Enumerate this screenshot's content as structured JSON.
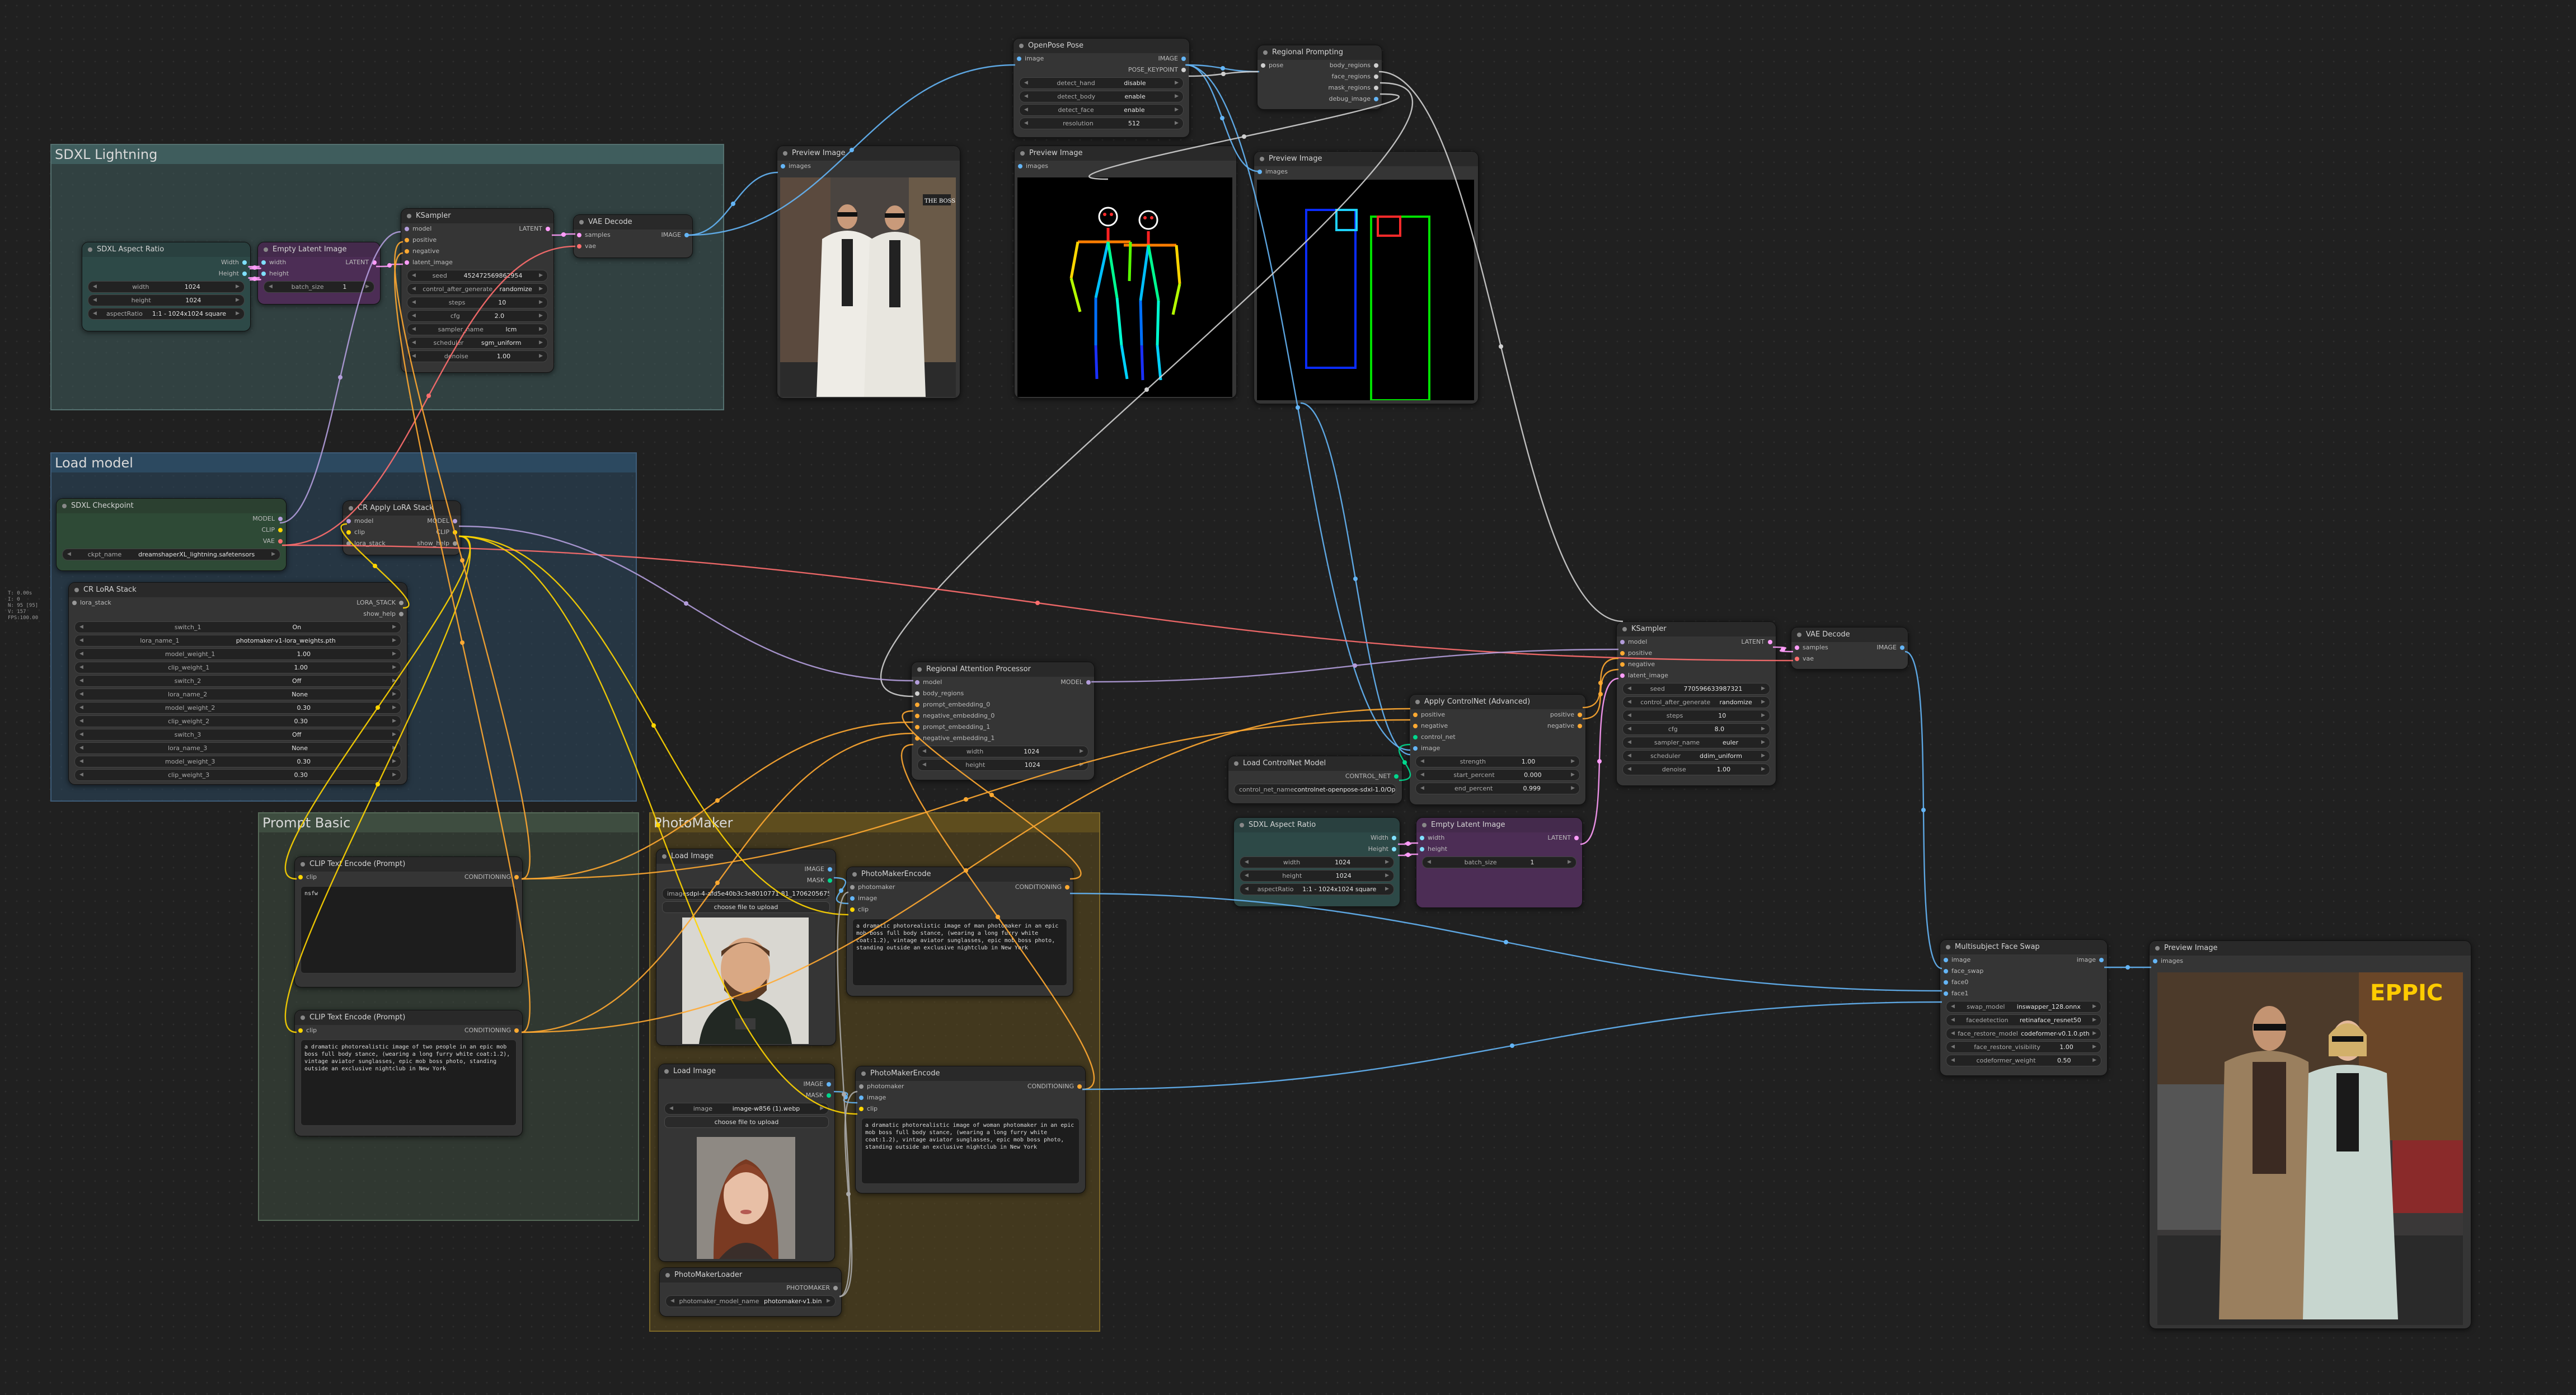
{
  "stats": [
    "T: 0.00s",
    "I: 0",
    "N: 95 [95]",
    "V: 157",
    "FPS:100.00"
  ],
  "groups": {
    "sdxl": "SDXL Lightning",
    "load": "Load model",
    "prompt": "Prompt Basic",
    "photomaker": "PhotoMaker"
  },
  "nodes": {
    "aspect1": {
      "title": "SDXL Aspect Ratio",
      "out": [
        "Width",
        "Height"
      ],
      "w": [
        [
          "width",
          "1024"
        ],
        [
          "height",
          "1024"
        ],
        [
          "aspectRatio",
          "1:1 - 1024x1024 square"
        ]
      ]
    },
    "latent1": {
      "title": "Empty Latent Image",
      "in": [
        "width",
        "height"
      ],
      "out": [
        "LATENT"
      ],
      "w": [
        [
          "batch_size",
          "1"
        ]
      ]
    },
    "ksampler1": {
      "title": "KSampler",
      "in": [
        "model",
        "positive",
        "negative",
        "latent_image"
      ],
      "out": [
        "LATENT"
      ],
      "w": [
        [
          "seed",
          "452472569862954"
        ],
        [
          "control_after_generate",
          "randomize"
        ],
        [
          "steps",
          "10"
        ],
        [
          "cfg",
          "2.0"
        ],
        [
          "sampler_name",
          "lcm"
        ],
        [
          "scheduler",
          "sgm_uniform"
        ],
        [
          "denoise",
          "1.00"
        ]
      ]
    },
    "vae1": {
      "title": "VAE Decode",
      "in": [
        "samples",
        "vae"
      ],
      "out": [
        "IMAGE"
      ]
    },
    "prev1": {
      "title": "Preview Image",
      "in": [
        "images"
      ]
    },
    "openpose": {
      "title": "OpenPose Pose",
      "in": [
        "image"
      ],
      "out": [
        "IMAGE",
        "POSE_KEYPOINT"
      ],
      "w": [
        [
          "detect_hand",
          "disable"
        ],
        [
          "detect_body",
          "enable"
        ],
        [
          "detect_face",
          "enable"
        ],
        [
          "resolution",
          "512"
        ]
      ]
    },
    "prev2": {
      "title": "Preview Image",
      "in": [
        "images"
      ]
    },
    "regional": {
      "title": "Regional Prompting",
      "in": [
        "pose"
      ],
      "out": [
        "body_regions",
        "face_regions",
        "mask_regions",
        "debug_image"
      ]
    },
    "prev3": {
      "title": "Preview Image",
      "in": [
        "images"
      ]
    },
    "checkpoint": {
      "title": "SDXL Checkpoint",
      "out": [
        "MODEL",
        "CLIP",
        "VAE"
      ],
      "w": [
        [
          "ckpt_name",
          "dreamshaperXL_lightning.safetensors"
        ]
      ]
    },
    "applylora": {
      "title": "CR Apply LoRA Stack",
      "in": [
        "model",
        "clip",
        "lora_stack"
      ],
      "out": [
        "MODEL",
        "CLIP",
        "show_help"
      ]
    },
    "lorastack": {
      "title": "CR LoRA Stack",
      "in": [
        "lora_stack"
      ],
      "out": [
        "LORA_STACK",
        "show_help"
      ],
      "w": [
        [
          "switch_1",
          "On"
        ],
        [
          "lora_name_1",
          "photomaker-v1-lora_weights.pth"
        ],
        [
          "model_weight_1",
          "1.00"
        ],
        [
          "clip_weight_1",
          "1.00"
        ],
        [
          "switch_2",
          "Off"
        ],
        [
          "lora_name_2",
          "None"
        ],
        [
          "model_weight_2",
          "0.30"
        ],
        [
          "clip_weight_2",
          "0.30"
        ],
        [
          "switch_3",
          "Off"
        ],
        [
          "lora_name_3",
          "None"
        ],
        [
          "model_weight_3",
          "0.30"
        ],
        [
          "clip_weight_3",
          "0.30"
        ]
      ]
    },
    "rap": {
      "title": "Regional Attention Processor",
      "in": [
        "model",
        "body_regions",
        "prompt_embedding_0",
        "negative_embedding_0",
        "prompt_embedding_1",
        "negative_embedding_1"
      ],
      "out": [
        "MODEL"
      ],
      "w": [
        [
          "width",
          "1024"
        ],
        [
          "height",
          "1024"
        ]
      ]
    },
    "ksampler2": {
      "title": "KSampler",
      "in": [
        "model",
        "positive",
        "negative",
        "latent_image"
      ],
      "out": [
        "LATENT"
      ],
      "w": [
        [
          "seed",
          "770596633987321"
        ],
        [
          "control_after_generate",
          "randomize"
        ],
        [
          "steps",
          "10"
        ],
        [
          "cfg",
          "8.0"
        ],
        [
          "sampler_name",
          "euler"
        ],
        [
          "scheduler",
          "ddim_uniform"
        ],
        [
          "denoise",
          "1.00"
        ]
      ]
    },
    "vae2": {
      "title": "VAE Decode",
      "in": [
        "samples",
        "vae"
      ],
      "out": [
        "IMAGE"
      ]
    },
    "controlnet": {
      "title": "Apply ControlNet (Advanced)",
      "in": [
        "positive",
        "negative",
        "control_net",
        "image"
      ],
      "out": [
        "positive",
        "negative"
      ],
      "w": [
        [
          "strength",
          "1.00"
        ],
        [
          "start_percent",
          "0.000"
        ],
        [
          "end_percent",
          "0.999"
        ]
      ]
    },
    "loadcn": {
      "title": "Load ControlNet Model",
      "out": [
        "CONTROL_NET"
      ],
      "w": [
        [
          "control_net_name",
          "controlnet-openpose-sdxl-1.0/OpenPoseXL2.safetensors"
        ]
      ]
    },
    "aspect2": {
      "title": "SDXL Aspect Ratio",
      "out": [
        "Width",
        "Height"
      ],
      "w": [
        [
          "width",
          "1024"
        ],
        [
          "height",
          "1024"
        ],
        [
          "aspectRatio",
          "1:1 - 1024x1024 square"
        ]
      ]
    },
    "latent2": {
      "title": "Empty Latent Image",
      "in": [
        "width",
        "height"
      ],
      "out": [
        "LATENT"
      ],
      "w": [
        [
          "batch_size",
          "1"
        ]
      ]
    },
    "clip1": {
      "title": "CLIP Text Encode (Prompt)",
      "in": [
        "clip"
      ],
      "out": [
        "CONDITIONING"
      ],
      "text": "nsfw"
    },
    "clip2": {
      "title": "CLIP Text Encode (Prompt)",
      "in": [
        "clip"
      ],
      "out": [
        "CONDITIONING"
      ],
      "text": "a dramatic photorealistic image of two people in an epic mob boss full body stance, (wearing a long furry white coat:1.2), vintage aviator sunglasses, epic mob boss photo, standing outside an exclusive nightclub in New York"
    },
    "loadimg1": {
      "title": "Load Image",
      "out": [
        "IMAGE",
        "MASK"
      ],
      "w": [
        [
          "image",
          "sdpl-4-afd5e40b3c3e8010771 81_1706205675863 (1) (5).jpg"
        ]
      ],
      "btn": "choose file to upload"
    },
    "pme1": {
      "title": "PhotoMakerEncode",
      "in": [
        "photomaker",
        "image",
        "clip"
      ],
      "out": [
        "CONDITIONING"
      ],
      "text": "a dramatic photorealistic image of man photomaker in an epic mob boss full body stance, (wearing a long furry white coat:1.2), vintage aviator sunglasses, epic mob boss photo, standing outside an exclusive nightclub in New York"
    },
    "loadimg2": {
      "title": "Load Image",
      "out": [
        "IMAGE",
        "MASK"
      ],
      "w": [
        [
          "image",
          "image-w856 (1).webp"
        ]
      ],
      "btn": "choose file to upload"
    },
    "pme2": {
      "title": "PhotoMakerEncode",
      "in": [
        "photomaker",
        "image",
        "clip"
      ],
      "out": [
        "CONDITIONING"
      ],
      "text": "a dramatic photorealistic image of woman photomaker in an epic mob boss full body stance, (wearing a long furry white coat:1.2), vintage aviator sunglasses, epic mob boss photo, standing outside an exclusive nightclub in New York"
    },
    "pmloader": {
      "title": "PhotoMakerLoader",
      "out": [
        "PHOTOMAKER"
      ],
      "w": [
        [
          "photomaker_model_name",
          "photomaker-v1.bin"
        ]
      ]
    },
    "faceswap": {
      "title": "Multisubject Face Swap",
      "in": [
        "image",
        "face_swap",
        "face0",
        "face1"
      ],
      "out": [
        "image"
      ],
      "w": [
        [
          "swap_model",
          "inswapper_128.onnx"
        ],
        [
          "facedetection",
          "retinaface_resnet50"
        ],
        [
          "face_restore_model",
          "codeformer-v0.1.0.pth"
        ],
        [
          "face_restore_visibility",
          "1.00"
        ],
        [
          "codeformer_weight",
          "0.50"
        ]
      ]
    },
    "prev4": {
      "title": "Preview Image",
      "in": [
        "images"
      ]
    }
  },
  "image_captions": {
    "prev4_sign": "EPPIC"
  },
  "colors": {
    "model": "#b39ddb",
    "clip": "#ffd500",
    "vae": "#ff6e6e",
    "image": "#64b5f6",
    "latent": "#ff9cf9",
    "cond": "#ffa931",
    "cn": "#00d78d",
    "pose": "#cfcfcf",
    "group_sdxl": "#3f5d5d",
    "group_load": "#2c4960",
    "group_prompt": "#3e4d40",
    "group_pm": "#5e4d1e"
  }
}
